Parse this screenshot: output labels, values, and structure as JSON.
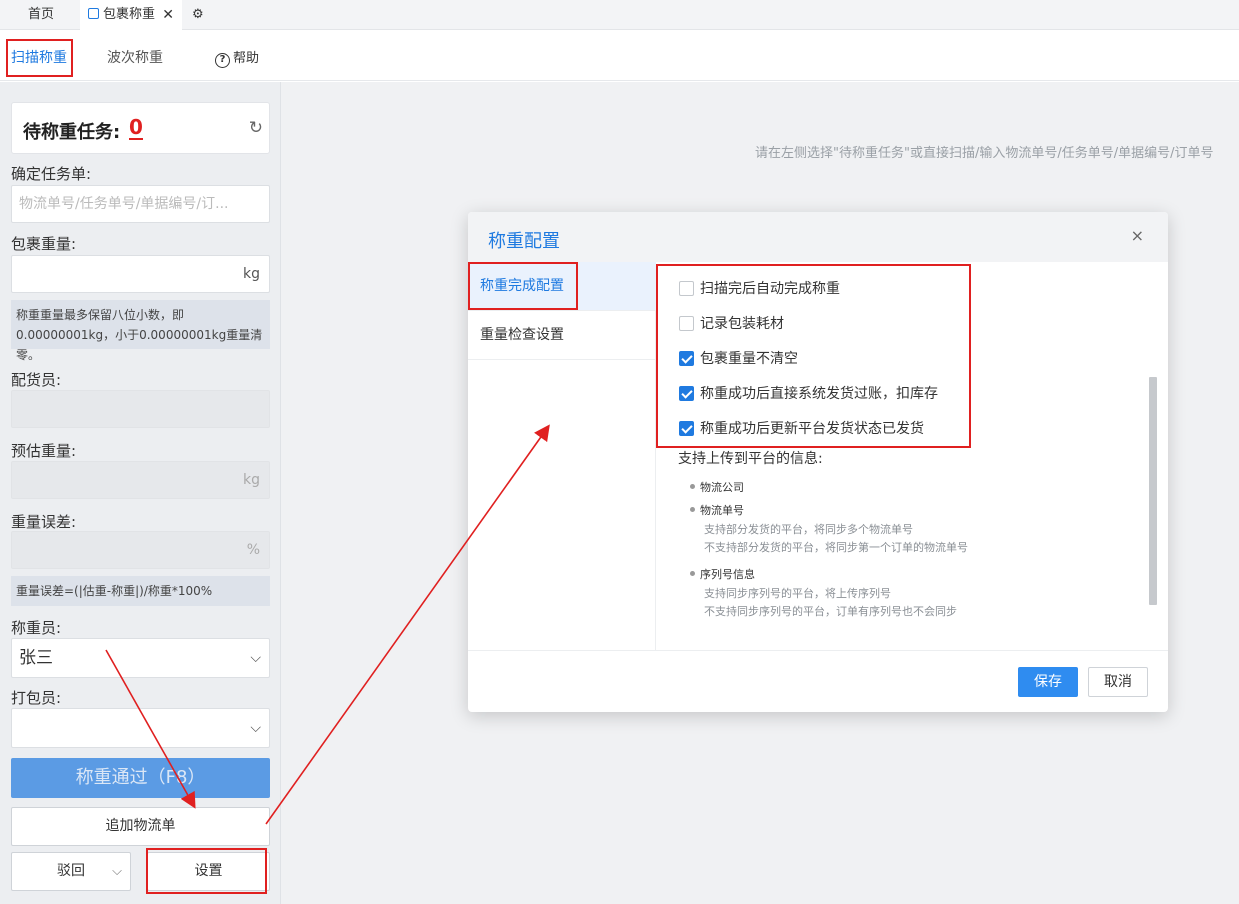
{
  "tabs": {
    "home": "首页",
    "active": "包裹称重",
    "close": "✕",
    "gear": "⚙"
  },
  "subtabs": {
    "scan": "扫描称重",
    "batch": "波次称重",
    "help_icon": "?",
    "help": "帮助"
  },
  "hint": "请在左侧选择\"待称重任务\"或直接扫描/输入物流单号/任务单号/单据编号/订单号",
  "left": {
    "pending_title": "待称重任务:",
    "pending_count": "0",
    "refresh_icon": "↻",
    "task_label": "确定任务单:",
    "task_placeholder": "物流单号/任务单号/单据编号/订...",
    "weight_label": "包裹重量:",
    "weight_unit": "kg",
    "weight_note": "称重重量最多保留八位小数，即0.00000001kg，小于0.00000001kg重量清零。",
    "picker_label": "配货员:",
    "est_label": "预估重量:",
    "est_unit": "kg",
    "err_label": "重量误差:",
    "err_unit": "%",
    "err_note": "重量误差=(|估重-称重|)/称重*100%",
    "weigher_label": "称重员:",
    "weigher_value": "张三",
    "packer_label": "打包员:",
    "packer_value": "",
    "pass_button": "称重通过（F8）",
    "add_button": "追加物流单",
    "reject_button": "驳回",
    "settings_button": "设置",
    "chevron": "⌵"
  },
  "modal": {
    "title": "称重配置",
    "close": "×",
    "nav": [
      "称重完成配置",
      "重量检查设置"
    ],
    "options": [
      {
        "label": "扫描完后自动完成称重",
        "checked": false
      },
      {
        "label": "记录包装耗材",
        "checked": false
      },
      {
        "label": "包裹重量不清空",
        "checked": true
      },
      {
        "label": "称重成功后直接系统发货过账，扣库存",
        "checked": true
      },
      {
        "label": "称重成功后更新平台发货状态已发货",
        "checked": true
      }
    ],
    "info_title": "支持上传到平台的信息:",
    "bullets": [
      {
        "title": "物流公司",
        "lines": []
      },
      {
        "title": "物流单号",
        "lines": [
          "支持部分发货的平台，将同步多个物流单号",
          "不支持部分发货的平台，将同步第一个订单的物流单号"
        ]
      },
      {
        "title": "序列号信息",
        "lines": [
          "支持同步序列号的平台，将上传序列号",
          "不支持同步序列号的平台，订单有序列号也不会同步"
        ]
      }
    ],
    "save": "保存",
    "cancel": "取消"
  },
  "colors": {
    "accent": "#1f7ae0",
    "annotation": "#e02020"
  }
}
